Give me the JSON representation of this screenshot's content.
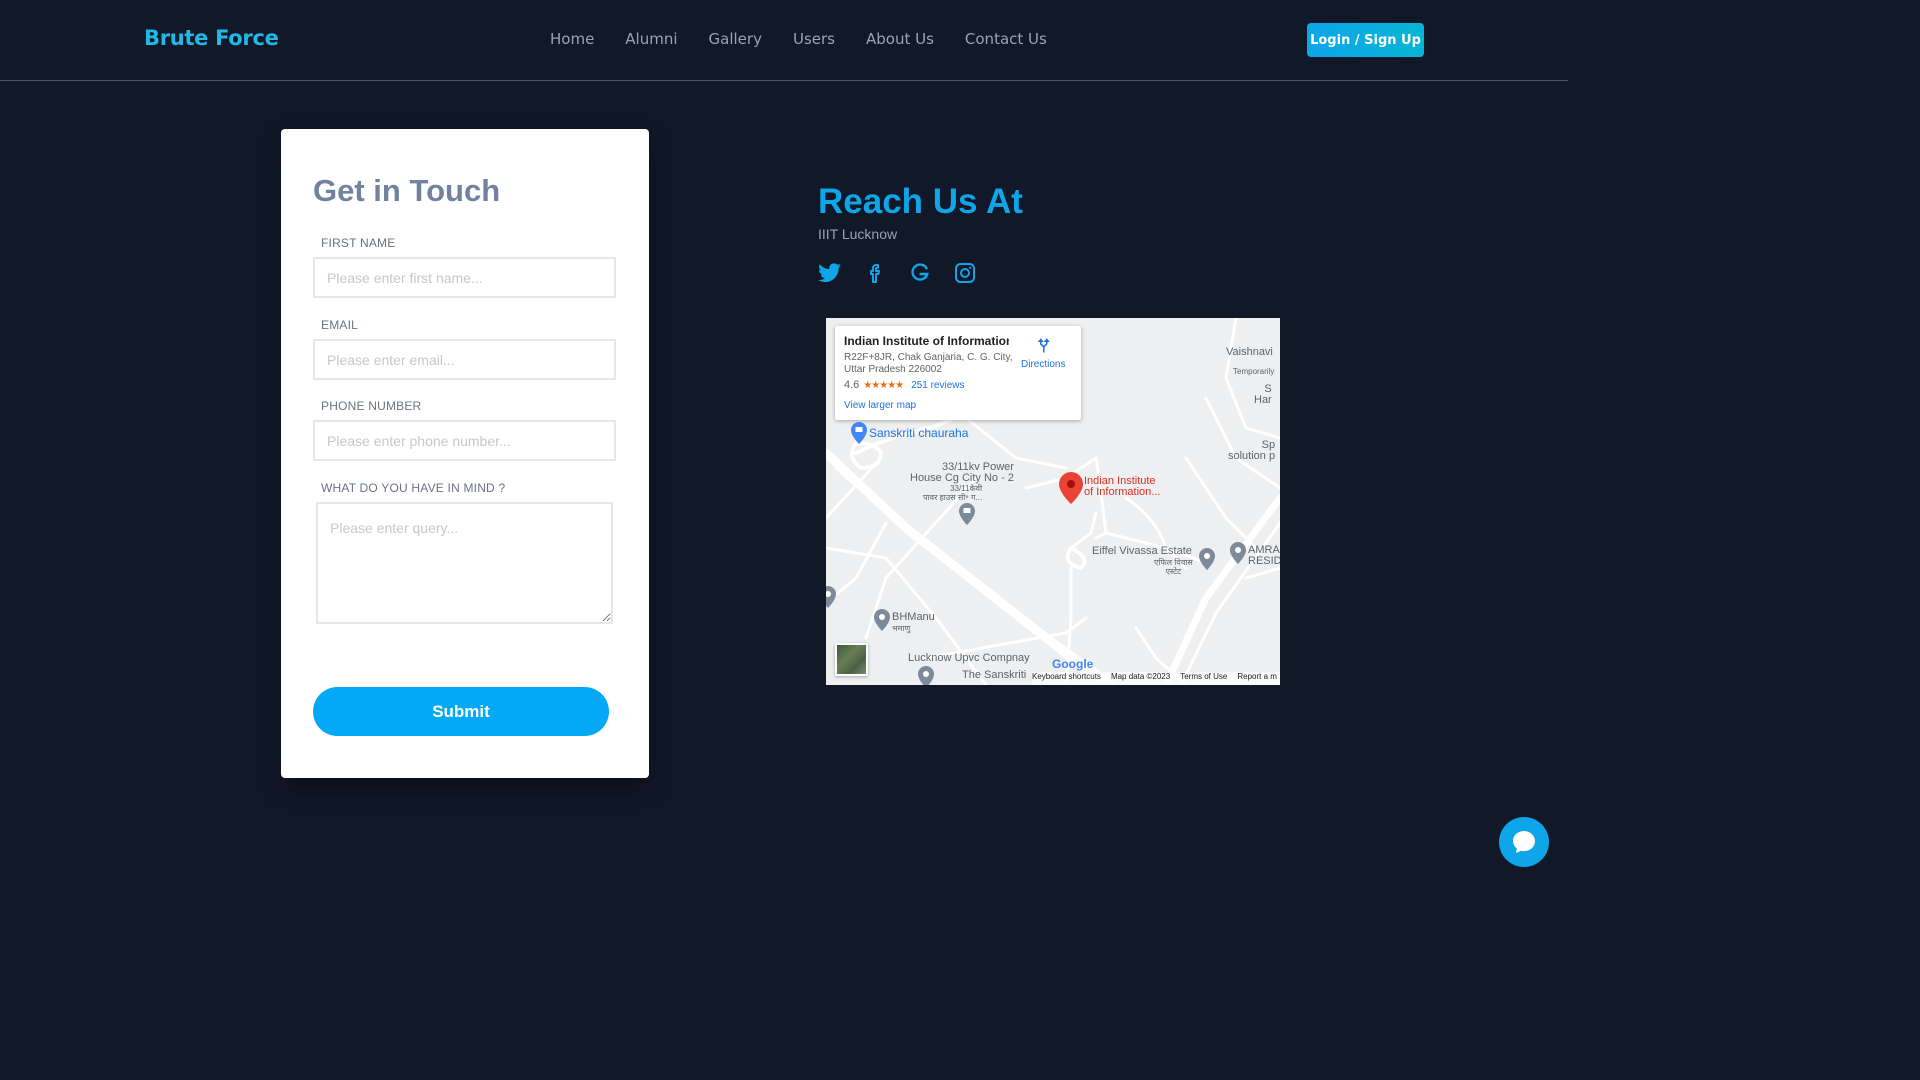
{
  "navbar": {
    "brand": "Brute Force",
    "links": [
      "Home",
      "Alumni",
      "Gallery",
      "Users",
      "About Us",
      "Contact Us"
    ],
    "login_label": "Login / Sign Up"
  },
  "contact_form": {
    "title": "Get in Touch",
    "fields": [
      {
        "label": "FIRST NAME",
        "placeholder": "Please enter first name..."
      },
      {
        "label": "EMAIL",
        "placeholder": "Please enter email..."
      },
      {
        "label": "PHONE NUMBER",
        "placeholder": "Please enter phone number..."
      },
      {
        "label": "WHAT DO YOU HAVE IN MIND ?",
        "placeholder": "Please enter query..."
      }
    ],
    "submit_label": "Submit"
  },
  "reach": {
    "title": "Reach Us At",
    "subtitle": "IIIT Lucknow",
    "socials": [
      "twitter-icon",
      "facebook-icon",
      "google-icon",
      "instagram-icon"
    ]
  },
  "map": {
    "place_title": "Indian Institute of Information...",
    "address": "R22F+8JR, Chak Ganjaria, C. G. City, Uttar Pradesh 226002",
    "rating": "4.6",
    "stars": "★★★★★",
    "reviews": "251 reviews",
    "view_larger": "View larger map",
    "directions": "Directions",
    "labels": {
      "sanskriti": "Sanskriti chauraha",
      "power_house": "33/11kv Power\nHouse Cg City No - 2",
      "power_house_hi": "33/11केवी\nपावर हाउस सी॰ ग...",
      "iiit": "Indian Institute\nof Information...",
      "eiffel": "Eiffel Vivassa Estate",
      "eiffel_hi": "एफिल विवास\nएस्टेट",
      "bhmanu": "BHManu",
      "bhmanu_hi": "भमाणु",
      "upvc": "Lucknow Upvc Compnay",
      "sanskriti_school": "The Sanskriti",
      "vaishnavi": "Vaishnavi",
      "temporarily": "Temporarily",
      "s_ha": "S\nHar",
      "sp_solution": "Sp\nsolution p",
      "amra": "AMRA\nRESID"
    },
    "google": "Google",
    "footer": [
      "Keyboard shortcuts",
      "Map data ©2023",
      "Terms of Use",
      "Report a m"
    ]
  },
  "colors": {
    "background": "#111827",
    "brand": "#22b8e5",
    "accent": "#03a9f4",
    "card_title": "#7182a0"
  }
}
